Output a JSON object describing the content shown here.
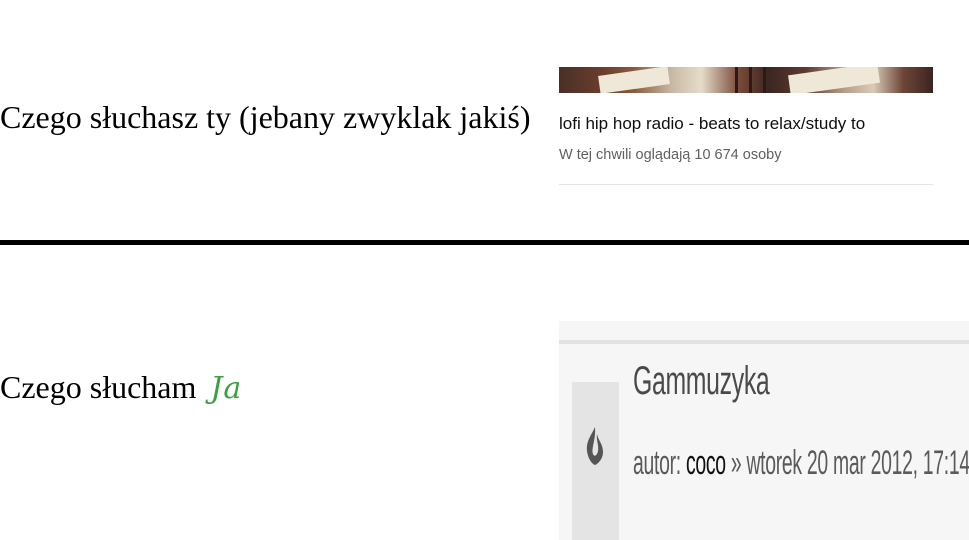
{
  "top_panel": {
    "caption": "Czego słuchasz ty (jebany zwyklak jakiś)",
    "video": {
      "title": "lofi hip hop radio - beats to relax/study to",
      "viewers": "W tej chwili oglądają 10 674 osoby"
    }
  },
  "bottom_panel": {
    "caption": "Czego słucham",
    "caption_signature": "Ja",
    "forum_post": {
      "title": "Gammuzyka",
      "author_prefix": "autor: ",
      "author": "coco",
      "date_text": " » wtorek 20 mar 2012, 17:14",
      "icon": "flame-icon"
    }
  },
  "colors": {
    "signature_green": "#3aa040",
    "separator": "#000000",
    "meta_gray": "#606060"
  }
}
